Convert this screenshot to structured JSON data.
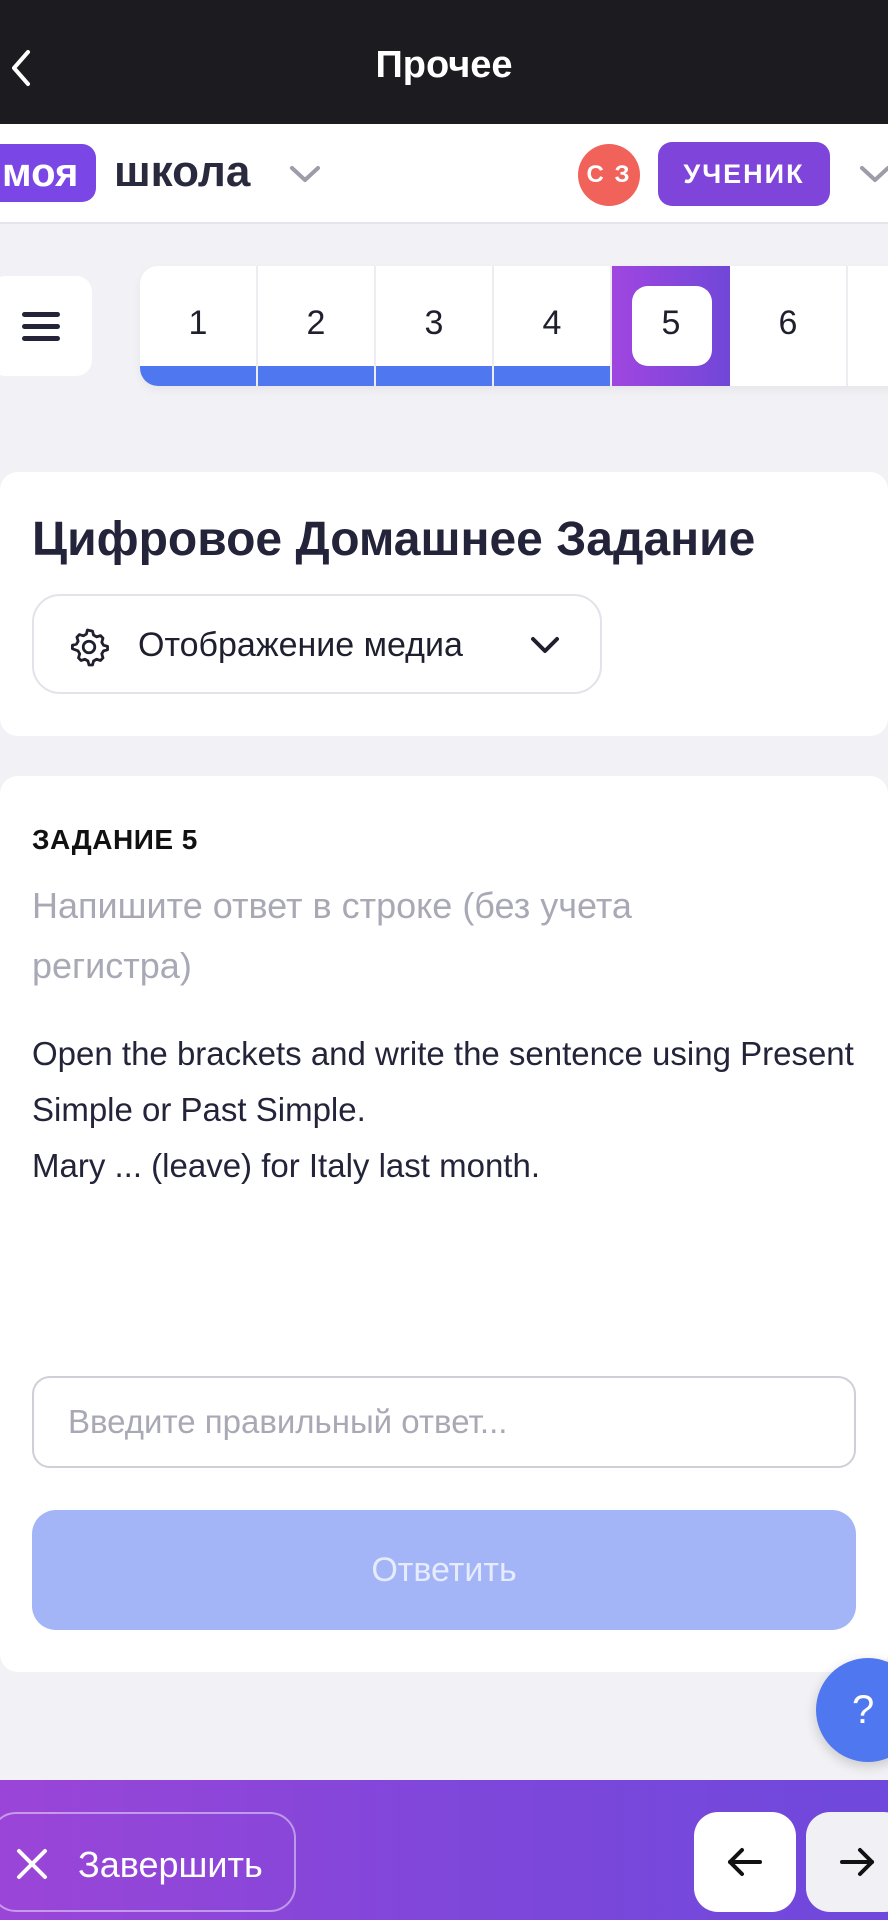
{
  "topbar": {
    "title": "Прочее"
  },
  "header": {
    "logo_part1": "моя",
    "logo_part2": "школа",
    "avatar_initials": "С З",
    "role": "УЧЕНИК"
  },
  "tasks": [
    {
      "num": "1",
      "done": true
    },
    {
      "num": "2",
      "done": true
    },
    {
      "num": "3",
      "done": true
    },
    {
      "num": "4",
      "done": true
    },
    {
      "num": "5",
      "active": true
    },
    {
      "num": "6",
      "done": false
    }
  ],
  "homework": {
    "title": "Цифровое Домашнее Задание",
    "media_label": "Отображение медиа"
  },
  "task": {
    "label": "ЗАДАНИЕ 5",
    "instruction": "Напишите ответ в строке (без учета регистра)",
    "question": "Open the brackets and write the sentence using Present Simple or Past Simple.\n Mary ... (leave) for Italy last month.",
    "answer_placeholder": "Введите правильный ответ...",
    "submit_label": "Ответить"
  },
  "help": {
    "label": "?"
  },
  "bottombar": {
    "finish_label": "Завершить"
  },
  "colors": {
    "accent_purple": "#7a47e6",
    "progress_blue": "#4f77ef",
    "avatar_red": "#f0625a",
    "submit_disabled": "#a4b5f7"
  },
  "icons": [
    "back-icon",
    "chevron-down-icon",
    "menu-icon",
    "gear-icon",
    "close-icon",
    "arrow-left-icon",
    "arrow-right-icon"
  ]
}
